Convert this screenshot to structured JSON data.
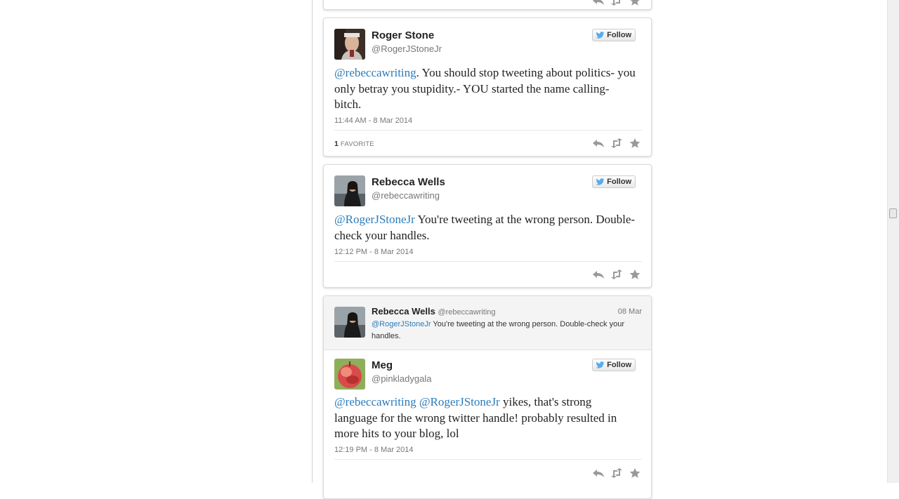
{
  "colors": {
    "link": "#2b7bb9",
    "twitter_blue": "#55acee"
  },
  "top_card": {
    "icons": [
      "reply-icon",
      "retweet-icon",
      "favorite-icon"
    ]
  },
  "tweets": [
    {
      "name": "Roger Stone",
      "handle": "@RogerJStoneJr",
      "follow_label": "Follow",
      "text_mention": "@rebeccawriting",
      "text_body": ". You should stop tweeting about politics- you only betray you stupidity.- YOU started the name calling- bitch.",
      "timestamp": "11:44 AM - 8 Mar 2014",
      "favorites_count": "1",
      "favorites_label": "FAVORITE"
    },
    {
      "name": "Rebecca Wells",
      "handle": "@rebeccawriting",
      "follow_label": "Follow",
      "text_mention": "@RogerJStoneJr",
      "text_body": " You're tweeting at the wrong person. Double-check your handles.",
      "timestamp": "12:12 PM - 8 Mar 2014"
    },
    {
      "quoted": {
        "name": "Rebecca Wells",
        "handle": "@rebeccawriting",
        "date": "08 Mar",
        "text_mention": "@RogerJStoneJr",
        "text_body": " You're tweeting at the wrong person. Double-check your handles."
      },
      "name": "Meg",
      "handle": "@pinkladygala",
      "follow_label": "Follow",
      "text_mention1": "@rebeccawriting",
      "text_mention2": "@RogerJStoneJr",
      "text_body": " yikes, that's strong language for the wrong twitter handle!  probably resulted in more hits to your blog, lol",
      "timestamp": "12:19 PM - 8 Mar 2014"
    }
  ]
}
